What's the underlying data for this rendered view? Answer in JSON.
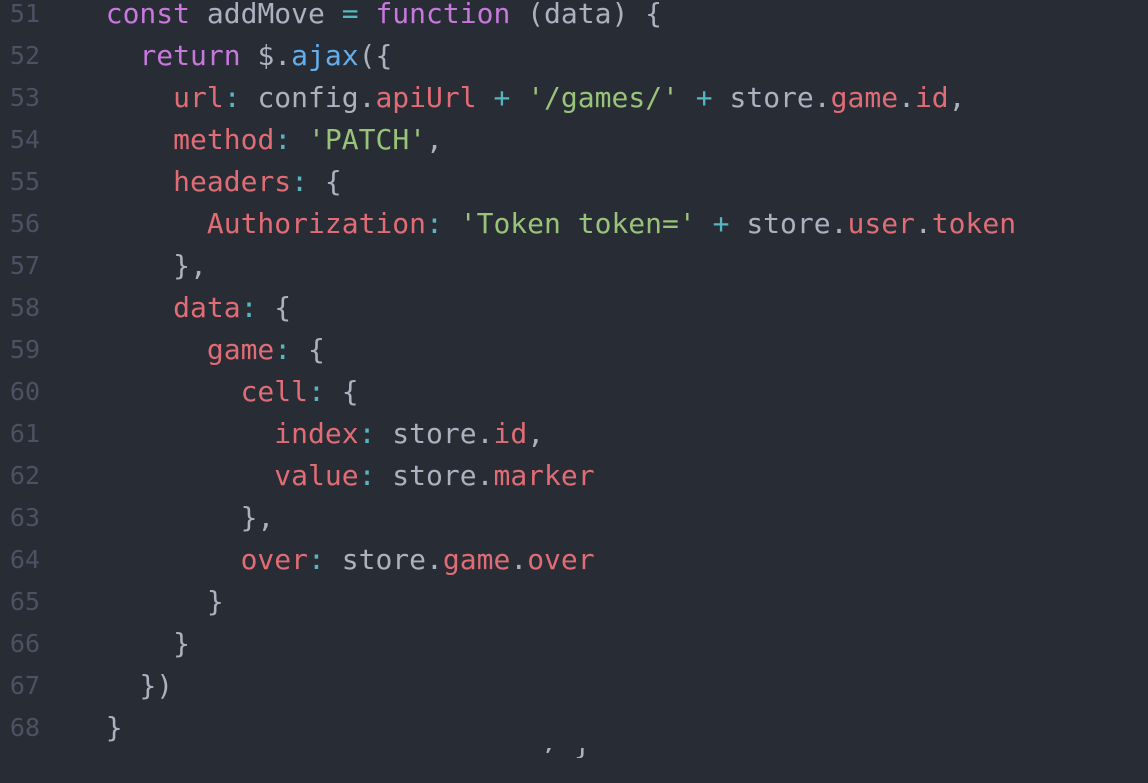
{
  "editor": {
    "lines": [
      {
        "num": "51",
        "indent": "  ",
        "tokens": [
          {
            "t": "const",
            "c": "keyword"
          },
          {
            "t": " addMove ",
            "c": "plain"
          },
          {
            "t": "=",
            "c": "op"
          },
          {
            "t": " ",
            "c": "plain"
          },
          {
            "t": "function",
            "c": "keyword"
          },
          {
            "t": " (data) {",
            "c": "plain"
          }
        ]
      },
      {
        "num": "52",
        "indent": "    ",
        "tokens": [
          {
            "t": "return",
            "c": "keyword"
          },
          {
            "t": " $.",
            "c": "plain"
          },
          {
            "t": "ajax",
            "c": "method"
          },
          {
            "t": "({",
            "c": "plain"
          }
        ]
      },
      {
        "num": "53",
        "indent": "      ",
        "tokens": [
          {
            "t": "url",
            "c": "prop"
          },
          {
            "t": ":",
            "c": "op"
          },
          {
            "t": " config.",
            "c": "plain"
          },
          {
            "t": "apiUrl",
            "c": "prop"
          },
          {
            "t": " ",
            "c": "plain"
          },
          {
            "t": "+",
            "c": "op"
          },
          {
            "t": " ",
            "c": "plain"
          },
          {
            "t": "'/games/'",
            "c": "string"
          },
          {
            "t": " ",
            "c": "plain"
          },
          {
            "t": "+",
            "c": "op"
          },
          {
            "t": " store.",
            "c": "plain"
          },
          {
            "t": "game",
            "c": "prop"
          },
          {
            "t": ".",
            "c": "plain"
          },
          {
            "t": "id",
            "c": "prop"
          },
          {
            "t": ",",
            "c": "plain"
          }
        ]
      },
      {
        "num": "54",
        "indent": "      ",
        "tokens": [
          {
            "t": "method",
            "c": "prop"
          },
          {
            "t": ":",
            "c": "op"
          },
          {
            "t": " ",
            "c": "plain"
          },
          {
            "t": "'PATCH'",
            "c": "string"
          },
          {
            "t": ",",
            "c": "plain"
          }
        ]
      },
      {
        "num": "55",
        "indent": "      ",
        "tokens": [
          {
            "t": "headers",
            "c": "prop"
          },
          {
            "t": ":",
            "c": "op"
          },
          {
            "t": " {",
            "c": "plain"
          }
        ]
      },
      {
        "num": "56",
        "indent": "        ",
        "tokens": [
          {
            "t": "Authorization",
            "c": "prop"
          },
          {
            "t": ":",
            "c": "op"
          },
          {
            "t": " ",
            "c": "plain"
          },
          {
            "t": "'Token token='",
            "c": "string"
          },
          {
            "t": " ",
            "c": "plain"
          },
          {
            "t": "+",
            "c": "op"
          },
          {
            "t": " store.",
            "c": "plain"
          },
          {
            "t": "user",
            "c": "prop"
          },
          {
            "t": ".",
            "c": "plain"
          },
          {
            "t": "token",
            "c": "prop"
          }
        ]
      },
      {
        "num": "57",
        "indent": "      ",
        "tokens": [
          {
            "t": "},",
            "c": "plain"
          }
        ]
      },
      {
        "num": "58",
        "indent": "      ",
        "tokens": [
          {
            "t": "data",
            "c": "prop"
          },
          {
            "t": ":",
            "c": "op"
          },
          {
            "t": " {",
            "c": "plain"
          }
        ]
      },
      {
        "num": "59",
        "indent": "        ",
        "tokens": [
          {
            "t": "game",
            "c": "prop"
          },
          {
            "t": ":",
            "c": "op"
          },
          {
            "t": " {",
            "c": "plain"
          }
        ]
      },
      {
        "num": "60",
        "indent": "          ",
        "tokens": [
          {
            "t": "cell",
            "c": "prop"
          },
          {
            "t": ":",
            "c": "op"
          },
          {
            "t": " {",
            "c": "plain"
          }
        ]
      },
      {
        "num": "61",
        "indent": "            ",
        "tokens": [
          {
            "t": "index",
            "c": "prop"
          },
          {
            "t": ":",
            "c": "op"
          },
          {
            "t": " store.",
            "c": "plain"
          },
          {
            "t": "id",
            "c": "prop"
          },
          {
            "t": ",",
            "c": "plain"
          }
        ]
      },
      {
        "num": "62",
        "indent": "            ",
        "tokens": [
          {
            "t": "value",
            "c": "prop"
          },
          {
            "t": ":",
            "c": "op"
          },
          {
            "t": " store.",
            "c": "plain"
          },
          {
            "t": "marker",
            "c": "prop"
          }
        ]
      },
      {
        "num": "63",
        "indent": "          ",
        "tokens": [
          {
            "t": "},",
            "c": "plain"
          }
        ]
      },
      {
        "num": "64",
        "indent": "          ",
        "tokens": [
          {
            "t": "over",
            "c": "prop"
          },
          {
            "t": ":",
            "c": "op"
          },
          {
            "t": " store.",
            "c": "plain"
          },
          {
            "t": "game",
            "c": "prop"
          },
          {
            "t": ".",
            "c": "plain"
          },
          {
            "t": "over",
            "c": "prop"
          }
        ]
      },
      {
        "num": "65",
        "indent": "        ",
        "tokens": [
          {
            "t": "}",
            "c": "plain"
          }
        ]
      },
      {
        "num": "66",
        "indent": "      ",
        "tokens": [
          {
            "t": "}",
            "c": "plain"
          }
        ]
      },
      {
        "num": "67",
        "indent": "    ",
        "tokens": [
          {
            "t": "})",
            "c": "plain"
          }
        ]
      },
      {
        "num": "68",
        "indent": "  ",
        "tokens": [
          {
            "t": "}",
            "c": "plain"
          }
        ]
      }
    ],
    "partial_next_line": "’ {"
  },
  "colors": {
    "background": "#282c34",
    "line_number": "#4b5263",
    "keyword": "#c678dd",
    "plain": "#abb2bf",
    "property": "#e06c75",
    "string": "#98c379",
    "operator": "#56b6c2",
    "method": "#61afef"
  }
}
